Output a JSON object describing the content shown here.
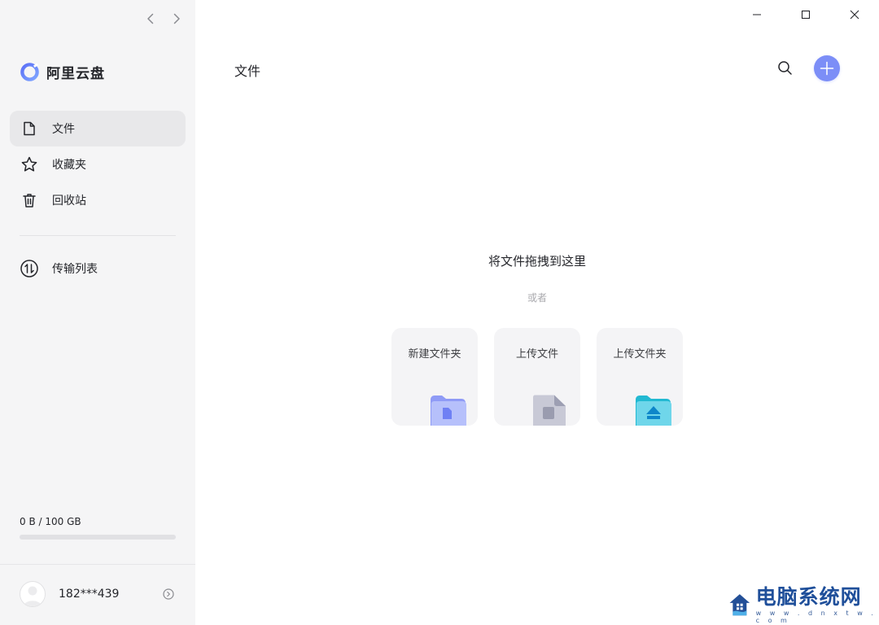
{
  "app": {
    "brand_name": "阿里云盘",
    "accent_color": "#637dff"
  },
  "sidebar": {
    "nav_items": [
      {
        "label": "文件",
        "icon": "file-icon",
        "active": true
      },
      {
        "label": "收藏夹",
        "icon": "star-icon",
        "active": false
      },
      {
        "label": "回收站",
        "icon": "trash-icon",
        "active": false
      }
    ],
    "transfer_label": "传输列表",
    "storage": {
      "text": "0 B / 100 GB",
      "used_fraction": 0
    },
    "user": {
      "name": "182***439"
    }
  },
  "main": {
    "title": "文件",
    "drop_title": "将文件拖拽到这里",
    "drop_or": "或者",
    "cards": [
      {
        "label": "新建文件夹",
        "icon": "new-folder-icon"
      },
      {
        "label": "上传文件",
        "icon": "upload-file-icon"
      },
      {
        "label": "上传文件夹",
        "icon": "upload-folder-icon"
      }
    ]
  },
  "watermark": {
    "title": "电脑系统网",
    "url": "w w w . d n x t w . c o m"
  }
}
